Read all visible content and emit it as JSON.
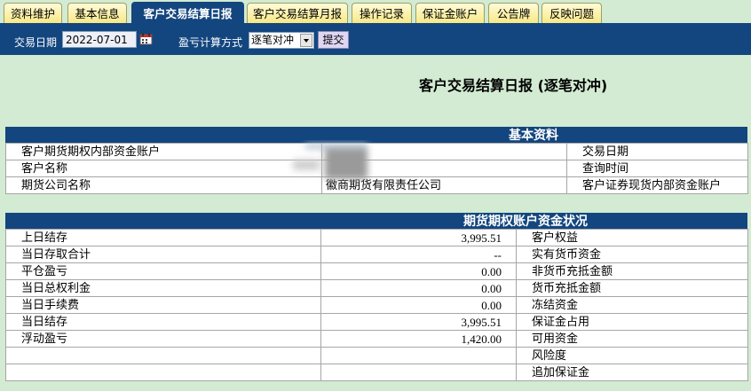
{
  "tabs": [
    {
      "label": "资料维护",
      "active": false
    },
    {
      "label": "基本信息",
      "active": false
    },
    {
      "label": "客户交易结算日报",
      "active": true
    },
    {
      "label": "客户交易结算月报",
      "active": false
    },
    {
      "label": "操作记录",
      "active": false
    },
    {
      "label": "保证金账户",
      "active": false
    },
    {
      "label": "公告牌",
      "active": false
    },
    {
      "label": "反映问题",
      "active": false
    }
  ],
  "toolbar": {
    "date_label": "交易日期",
    "date_value": "2022-07-01",
    "calc_label": "盈亏计算方式",
    "calc_value": "逐笔对冲",
    "submit_label": "提交"
  },
  "report": {
    "title": "客户交易结算日报  (逐笔对冲)"
  },
  "basic_info": {
    "header": "基本资料",
    "rows": [
      {
        "left_label": "客户期货期权内部资金账户",
        "left_value": "",
        "right_label": "交易日期"
      },
      {
        "left_label": "客户名称",
        "left_value": "",
        "right_label": "查询时间"
      },
      {
        "left_label": "期货公司名称",
        "left_value": "徽商期货有限责任公司",
        "right_label": "客户证券现货内部资金账户"
      }
    ]
  },
  "funds": {
    "header": "期货期权账户资金状况",
    "rows": [
      {
        "left_label": "上日结存",
        "left_value": "3,995.51",
        "right_label": "客户权益"
      },
      {
        "left_label": "当日存取合计",
        "left_value": "--",
        "right_label": "实有货币资金"
      },
      {
        "left_label": "平仓盈亏",
        "left_value": "0.00",
        "right_label": "非货币充抵金额"
      },
      {
        "left_label": "当日总权利金",
        "left_value": "0.00",
        "right_label": "货币充抵金额"
      },
      {
        "left_label": "当日手续费",
        "left_value": "0.00",
        "right_label": "冻结资金"
      },
      {
        "left_label": "当日结存",
        "left_value": "3,995.51",
        "right_label": "保证金占用"
      },
      {
        "left_label": "浮动盈亏",
        "left_value": "1,420.00",
        "right_label": "可用资金"
      },
      {
        "left_label": "",
        "left_value": "",
        "right_label": "风险度"
      },
      {
        "left_label": "",
        "left_value": "",
        "right_label": "追加保证金"
      }
    ]
  },
  "colors": {
    "page_bg": "#d2ebd2",
    "nav_blue": "#13467f",
    "tab_yellow": "#f7e77e",
    "submit_bg": "#ded6f2"
  },
  "icons": {
    "calendar": "calendar-icon",
    "dropdown": "chevron-down-icon"
  }
}
